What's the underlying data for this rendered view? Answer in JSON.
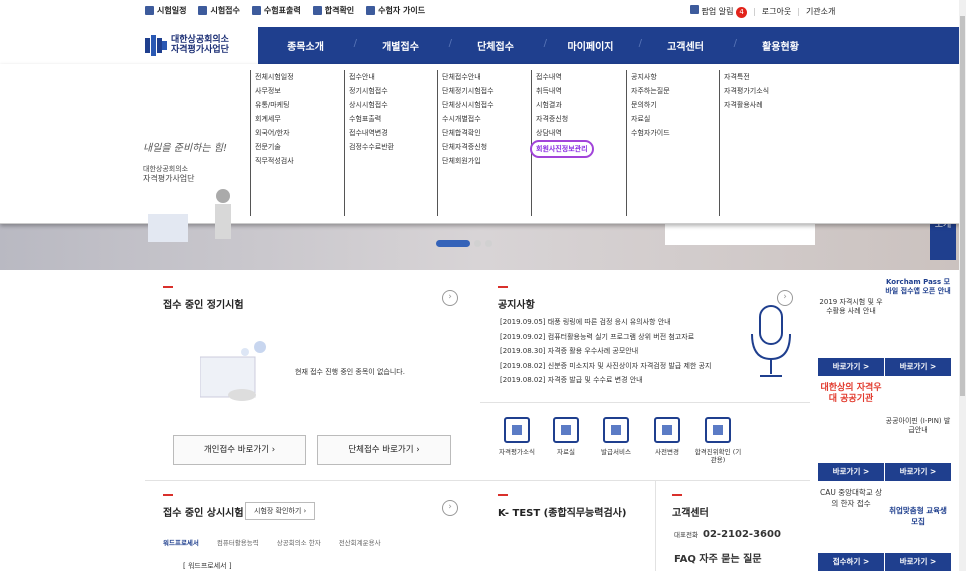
{
  "util": {
    "left": [
      "시험일정",
      "시험접수",
      "수험표출력",
      "합격확인",
      "수험자 가이드"
    ],
    "popup": "팝업 알림",
    "popup_count": "4",
    "login": "로그아웃",
    "agency": "기관소개"
  },
  "logo": {
    "line1": "대한상공회의소",
    "line2": "자격평가사업단"
  },
  "gnb": [
    "종목소개",
    "개별접수",
    "단체접수",
    "마이페이지",
    "고객센터",
    "활용현황"
  ],
  "mega": {
    "col1": [
      "전체시험일정",
      "사무정보",
      "유통/마케팅",
      "회계세무",
      "외국어/한자",
      "전문기술",
      "직무적성검사"
    ],
    "col2": [
      "접수안내",
      "정기시험접수",
      "상시시험접수",
      "수험표출력",
      "접수내역변경",
      "검정수수료반환"
    ],
    "col3": [
      "단체접수안내",
      "단체정기시험접수",
      "단체상시시험접수",
      "수시개별접수",
      "단체합격확인",
      "단체자격증신청",
      "단체회원가입"
    ],
    "col4": [
      "접수내역",
      "취득내역",
      "시험결과",
      "자격증신청",
      "상담내역",
      "회원사진정보관리"
    ],
    "col5": [
      "공지사항",
      "자주하는질문",
      "문의하기",
      "자료실",
      "수험자가이드"
    ],
    "col6": [
      "자격특전",
      "자격평가기소식",
      "자격활용사례"
    ]
  },
  "promo": {
    "hand": "내일을 준비하는 힘!",
    "org1": "대한상공회의소",
    "org2": "자격평가사업단"
  },
  "intro_tab": "소개",
  "regular": {
    "title": "접수 중인 정기시험",
    "empty": "현재 접수 진행 중인 종목이 없습니다.",
    "btn_personal": "개인접수 바로가기",
    "btn_group": "단체접수 바로가기"
  },
  "notice": {
    "title": "공지사항",
    "items": [
      "[2019.09.05] 태풍 링링에 따른 검정 응시 유의사항 안내",
      "[2019.09.02] 컴퓨터활용능력 실기 프로그램 상위 버전 첨고자료",
      "[2019.08.30] 자격증 활용 우수사례 공모안내",
      "[2019.08.02] 신분증 미소지자 및 사진상이자 자격검정 발급 제한 공지",
      "[2019.08.02] 자격증 발급 및 수수료 변경 안내"
    ]
  },
  "services": [
    "자격평가소식",
    "자료실",
    "발급서비스",
    "사전변경",
    "합격진위확인 (기관용)"
  ],
  "sidebar": [
    {
      "body": "2019 자격시험 및 우수활용 사례 안내",
      "foot": "바로가기 >"
    },
    {
      "body": "Korcham Pass 모바일 접수앱 오픈 안내",
      "foot": "바로가기 >"
    },
    {
      "body": "대한상의 자격우대 공공기관",
      "foot": "바로가기 >"
    },
    {
      "body": "공공아이핀 (I-PIN) 발급안내",
      "foot": "바로가기 >"
    },
    {
      "body": "CAU 중앙대학교 상의 한자 접수",
      "foot": "접수하기 >"
    },
    {
      "body": "취업맞춤형 교육생 모집",
      "foot": "바로가기 >"
    }
  ],
  "ondemand": {
    "title": "접수 중인 상시시험",
    "check": "시험장 확인하기",
    "tabs": [
      "워드프로세서",
      "컴퓨터활용능력",
      "상공회의소 한자",
      "전산회계운용사"
    ],
    "first": "[ 워드프로세서 ]"
  },
  "ktest": {
    "title": "K- TEST (종합직무능력검사)"
  },
  "cs": {
    "title": "고객센터",
    "label": "대표전화",
    "phone": "02-2102-3600",
    "faq": "FAQ 자주 묻는 질문"
  }
}
